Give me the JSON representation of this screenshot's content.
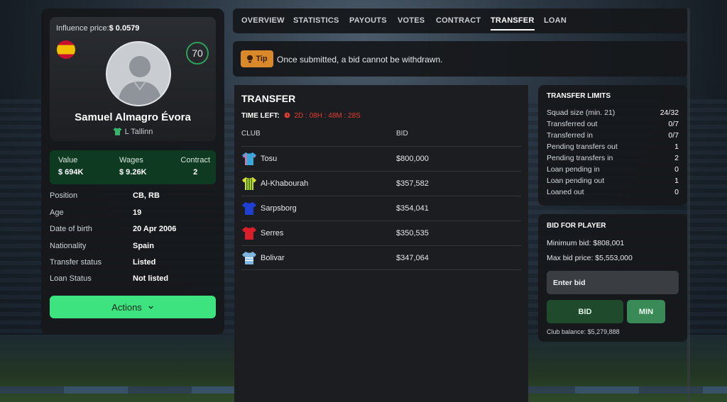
{
  "player": {
    "influence_label": "Influence price:",
    "influence_value": "$ 0.0579",
    "rating": "70",
    "name": "Samuel Almagro Évora",
    "club": "L Tallinn",
    "flag_icon": "spain-flag-icon",
    "stats": {
      "value_label": "Value",
      "value": "$ 694K",
      "wages_label": "Wages",
      "wages": "$ 9.26K",
      "contract_label": "Contract",
      "contract": "2"
    },
    "info": [
      {
        "label": "Position",
        "value": "CB, RB"
      },
      {
        "label": "Age",
        "value": "19"
      },
      {
        "label": "Date of birth",
        "value": "20 Apr 2006"
      },
      {
        "label": "Nationality",
        "value": "Spain"
      },
      {
        "label": "Transfer status",
        "value": "Listed"
      },
      {
        "label": "Loan Status",
        "value": "Not listed"
      }
    ],
    "actions_label": "Actions"
  },
  "tabs": [
    {
      "label": "OVERVIEW",
      "active": false
    },
    {
      "label": "STATISTICS",
      "active": false
    },
    {
      "label": "PAYOUTS",
      "active": false
    },
    {
      "label": "VOTES",
      "active": false
    },
    {
      "label": "CONTRACT",
      "active": false
    },
    {
      "label": "TRANSFER",
      "active": true
    },
    {
      "label": "LOAN",
      "active": false
    }
  ],
  "tip": {
    "badge": "Tip",
    "text": "Once submitted, a bid cannot be withdrawn."
  },
  "transfer": {
    "title": "TRANSFER",
    "time_left_label": "TIME LEFT:",
    "time_left_value": "2D : 08H : 48M : 28S",
    "col_club": "CLUB",
    "col_bid": "BID",
    "bids": [
      {
        "club": "Tosu",
        "bid": "$800,000",
        "shirt": "#3aa7d9",
        "accent": "#e76fa8"
      },
      {
        "club": "Al-Khabourah",
        "bid": "$357,582",
        "shirt": "#d6e02a",
        "accent": "#1f6b2a"
      },
      {
        "club": "Sarpsborg",
        "bid": "$354,041",
        "shirt": "#1e3fd1",
        "accent": "#1e3fd1"
      },
      {
        "club": "Serres",
        "bid": "$350,535",
        "shirt": "#d8202a",
        "accent": "#d8202a"
      },
      {
        "club": "Bolivar",
        "bid": "$347,064",
        "shirt": "#7fb6e0",
        "accent": "#ffffff"
      }
    ]
  },
  "limits": {
    "title": "TRANSFER LIMITS",
    "rows": [
      {
        "label": "Squad size (min. 21)",
        "value": "24/32"
      },
      {
        "label": "Transferred out",
        "value": "0/7"
      },
      {
        "label": "Transferred in",
        "value": "0/7"
      },
      {
        "label": "Pending transfers out",
        "value": "1"
      },
      {
        "label": "Pending transfers in",
        "value": "2"
      },
      {
        "label": "Loan pending in",
        "value": "0"
      },
      {
        "label": "Loan pending out",
        "value": "1"
      },
      {
        "label": "Loaned out",
        "value": "0"
      }
    ]
  },
  "bid": {
    "title": "BID FOR PLAYER",
    "minimum_label": "Minimum bid:",
    "minimum_value": "$808,001",
    "max_label": "Max bid price:",
    "max_value": "$5,553,000",
    "input_placeholder": "Enter bid",
    "bid_button": "BID",
    "min_button": "MIN",
    "balance_label": "Club balance:",
    "balance_value": "$5,279,888"
  }
}
